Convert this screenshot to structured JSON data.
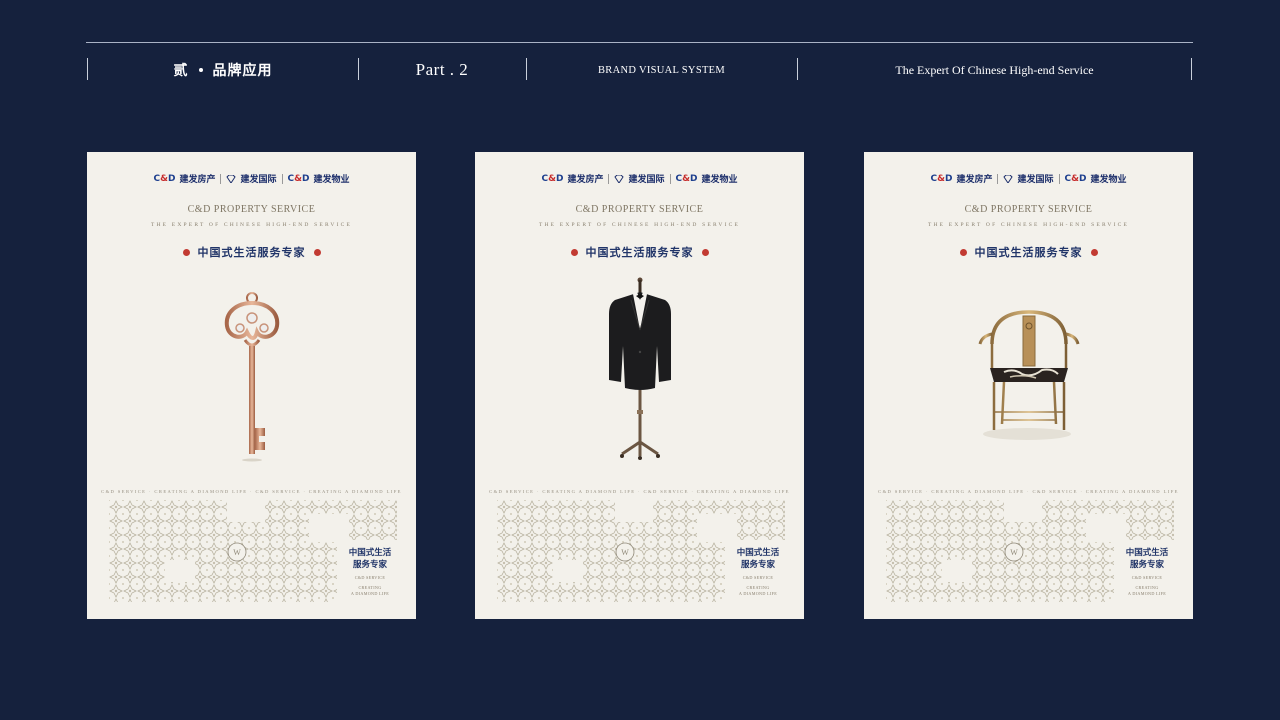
{
  "header": {
    "chapter": "贰",
    "chapter_title": "品牌应用",
    "part": "Part . 2",
    "caption": "BRAND VISUAL SYSTEM",
    "tagline": "The Expert Of Chinese High-end Service"
  },
  "poster_common": {
    "logo_fang": "建发房产",
    "logo_intl": "建发国际",
    "logo_wuye": "建发物业",
    "cd_left": "C",
    "cd_amp": "&",
    "cd_right": "D",
    "title_en": "C&D PROPERTY SERVICE",
    "subtitle_en": "THE EXPERT OF CHINESE HIGH-END SERVICE",
    "title_zh": "中国式生活服务专家",
    "ribbon": "C&D SERVICE · CREATING A DIAMOND LIFE · C&D SERVICE · CREATING A DIAMOND LIFE",
    "slogan_zh_1": "中国式生活",
    "slogan_zh_2": "服务专家",
    "slogan_en_1": "C&D SERVICE",
    "slogan_en_2": "CREATING",
    "slogan_en_3": "A DIAMOND LIFE"
  },
  "posters": [
    {
      "product_icon": "key-icon"
    },
    {
      "product_icon": "suit-icon"
    },
    {
      "product_icon": "chair-icon"
    }
  ],
  "colors": {
    "background": "#15213d",
    "poster": "#f3f1eb",
    "brand_blue": "#1d3f8e",
    "brand_red": "#c62a2a",
    "gold": "#c9a36a"
  }
}
